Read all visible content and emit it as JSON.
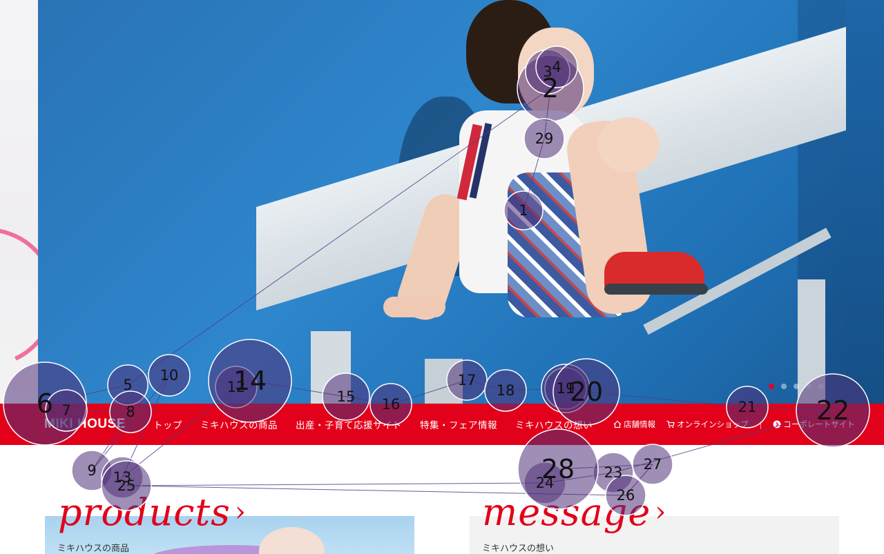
{
  "brand": {
    "logo_text": "MIKI HOUSE",
    "accent": "#e2001a"
  },
  "hero": {
    "slide_count": 5,
    "active_slide": 1
  },
  "nav": {
    "main_items": [
      "トップ",
      "ミキハウスの商品",
      "出産・子育て応援サイト",
      "特集・フェア情報",
      "ミキハウスの想い"
    ],
    "store_info": "店舗情報",
    "online_shop": "オンラインショップ",
    "separator": "|",
    "corporate_site": "コーポレートサイト"
  },
  "sections": {
    "products": {
      "title": "products",
      "subtitle": "ミキハウスの商品"
    },
    "message": {
      "title": "message",
      "subtitle": "ミキハウスの想い"
    }
  },
  "gaze": {
    "fixations": [
      {
        "n": "1"
      },
      {
        "n": "2"
      },
      {
        "n": "3"
      },
      {
        "n": "4"
      },
      {
        "n": "5"
      },
      {
        "n": "6"
      },
      {
        "n": "7"
      },
      {
        "n": "8"
      },
      {
        "n": "9"
      },
      {
        "n": "10"
      },
      {
        "n": "11"
      },
      {
        "n": "12"
      },
      {
        "n": "13"
      },
      {
        "n": "14"
      },
      {
        "n": "15"
      },
      {
        "n": "16"
      },
      {
        "n": "17"
      },
      {
        "n": "18"
      },
      {
        "n": "19"
      },
      {
        "n": "20"
      },
      {
        "n": "21"
      },
      {
        "n": "22"
      },
      {
        "n": "23"
      },
      {
        "n": "24"
      },
      {
        "n": "25"
      },
      {
        "n": "26"
      },
      {
        "n": "27"
      },
      {
        "n": "28"
      },
      {
        "n": "29"
      }
    ]
  }
}
